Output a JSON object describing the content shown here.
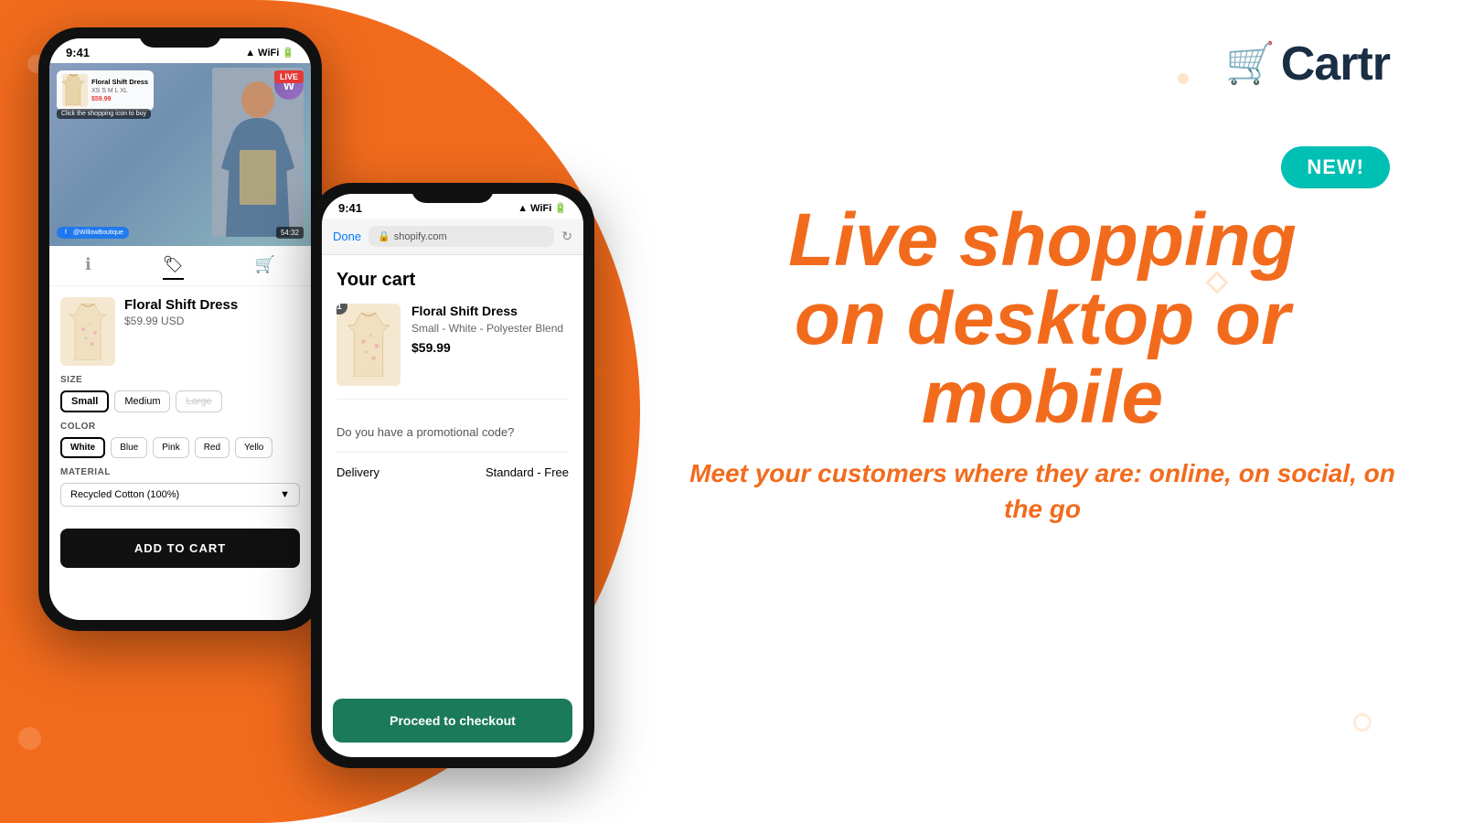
{
  "brand": {
    "name": "Cartr",
    "logo_icon": "🛒"
  },
  "badge_new": "NEW!",
  "headline": {
    "line1": "Live shopping",
    "line2": "on desktop or",
    "line3": "mobile",
    "subtext": "Meet your customers where they are: online, on social, on the go"
  },
  "back_phone": {
    "status_time": "9:41",
    "live_badge": "LIVE",
    "click_hint": "Click the shopping icon to buy",
    "account_initial": "W",
    "fb_handle": "@WillowBoutique",
    "video_time": "54:32",
    "product_popup": {
      "name": "Floral Shift Dress",
      "sizes": "XS S M L XL",
      "price": "$59.99"
    },
    "nav_tabs": [
      "info",
      "tag",
      "cart"
    ],
    "active_tab": 1,
    "product": {
      "name": "Floral Shift Dress",
      "price": "$59.99 USD"
    },
    "size_label": "SIZE",
    "sizes": [
      {
        "label": "Small",
        "selected": true
      },
      {
        "label": "Medium",
        "selected": false
      },
      {
        "label": "Large",
        "disabled": true
      }
    ],
    "color_label": "COLOR",
    "colors": [
      {
        "label": "White",
        "selected": true
      },
      {
        "label": "Blue",
        "selected": false
      },
      {
        "label": "Pink",
        "selected": false
      },
      {
        "label": "Red",
        "selected": false
      },
      {
        "label": "Yellow",
        "selected": false
      }
    ],
    "material_label": "MATERIAL",
    "material_value": "Recycled Cotton (100%)",
    "add_to_cart": "ADD TO CART"
  },
  "front_phone": {
    "status_time": "9:41",
    "browser_done": "Done",
    "browser_url": "shopify.com",
    "cart_title": "Your cart",
    "cart_item": {
      "qty": 1,
      "name": "Floral Shift Dress",
      "variant": "Small - White - Polyester Blend",
      "price": "$59.99"
    },
    "promo_text": "Do you have a promotional code?",
    "delivery_label": "Delivery",
    "delivery_value": "Standard - Free",
    "checkout_btn": "Proceed to checkout"
  }
}
